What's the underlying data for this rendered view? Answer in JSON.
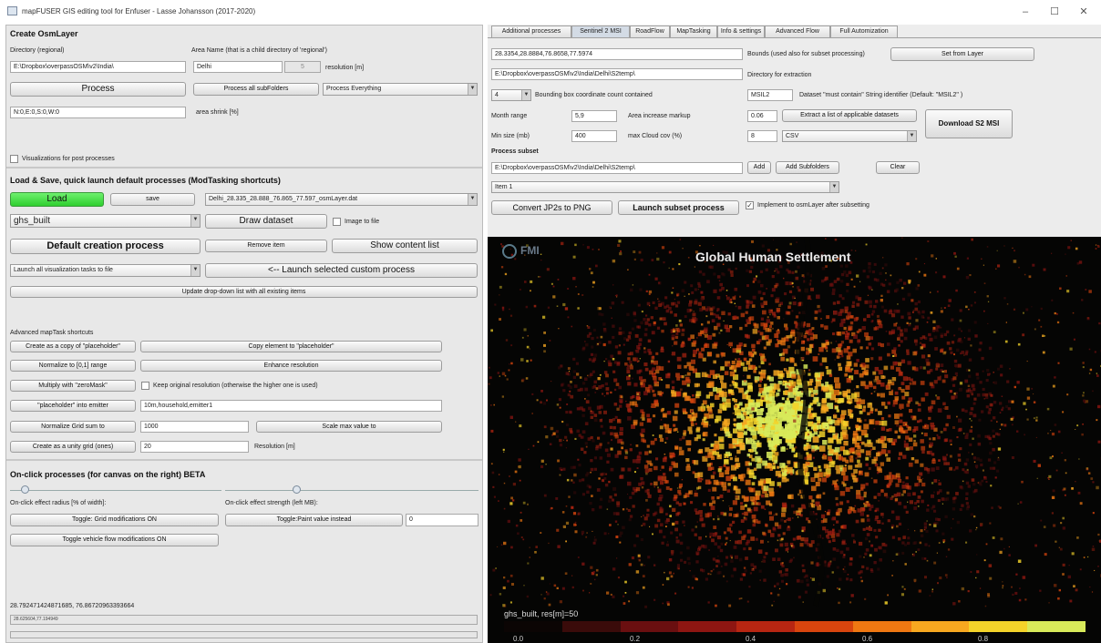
{
  "window": {
    "title": "mapFUSER GIS editing tool for Enfuser - Lasse Johansson (2017-2020)",
    "minimize": "–",
    "maximize": "☐",
    "close": "✕"
  },
  "create_osm": {
    "title": "Create OsmLayer",
    "dir_label": "Directory (regional)",
    "dir_value": "E:\\Dropbox\\overpassOSM\\v2\\India\\",
    "area_label": "Area Name (that is a child directory of 'regional')",
    "area_value": "Delhi",
    "res_value": "5",
    "res_label": "resolution [m]",
    "process_btn": "Process",
    "process_all_btn": "Process all subFolders",
    "process_mode": "Process Everything",
    "shrink_value": "N:0,E:0,S:0,W:0",
    "shrink_label": "area shrink [%]",
    "vis_label": "Visualizations for post processes"
  },
  "load_save": {
    "title": "Load & Save, quick launch default processes (ModTasking shortcuts)",
    "load_btn": "Load",
    "save_btn": "save",
    "file_value": "Delhi_28.335_28.888_76.865_77.597_osmLayer.dat",
    "dataset_value": "ghs_built",
    "draw_btn": "Draw dataset",
    "image_label": "Image to file",
    "default_btn": "Default creation process",
    "remove_btn": "Remove item",
    "show_btn": "Show content list",
    "launch_all": "Launch all visualization tasks to file",
    "launch_custom_btn": "<-- Launch selected custom process",
    "update_btn": "Update drop-down list with all existing items",
    "adv_label": "Advanced mapTask shortcuts",
    "copy_as_btn": "Create as a copy of \"placeholder\"",
    "copy_to_btn": "Copy element to \"placeholder\"",
    "normalize_btn": "Normalize to [0,1] range",
    "enhance_btn": "Enhance resolution",
    "multiply_btn": "Multiply with \"zeroMask\"",
    "keep_label": "Keep original resolution (otherwise the higher one is used)",
    "emitter_btn": "\"placeholder\" into emitter",
    "emitter_value": "10m,household,emitter1",
    "grid_sum_btn": "Normalize Grid sum to",
    "grid_sum_value": "1000",
    "scale_btn": "Scale max value to",
    "unity_btn": "Create as a unity grid (ones)",
    "unity_value": "20",
    "res_label": "Resolution [m]"
  },
  "onclick": {
    "title": "On-click processes (for canvas on the right) BETA",
    "radius_label": "On-click effect radius [% of width]:",
    "strength_label": "On-click effect strength (left MB):",
    "radius_level": 0.07,
    "strength_level": 0.28,
    "grid_btn": "Toggle: Grid modifications ON",
    "paint_btn": "Toggle:Paint value instead",
    "paint_value": "0",
    "vehicle_btn": "Toggle vehicle flow modifications ON",
    "coords": "28.792471424871685, 76.86720963393664",
    "coords2": "28.625604,77.194949"
  },
  "tabs": [
    {
      "label": "Additional processes",
      "active": false
    },
    {
      "label": "Sentinel 2 MSI",
      "active": true
    },
    {
      "label": "RoadFlow",
      "active": false
    },
    {
      "label": "MapTasking",
      "active": false
    },
    {
      "label": "Info & settings",
      "active": false
    },
    {
      "label": "Advanced Flow",
      "active": false
    },
    {
      "label": "Full Automization",
      "active": false
    }
  ],
  "sentinel": {
    "bounds_value": "28.3354,28.8884,76.8658,77.5974",
    "bounds_label": "Bounds (used also for subset processing)",
    "set_layer_btn": "Set from Layer",
    "dir_value": "E:\\Dropbox\\overpassOSM\\v2\\India\\Delhi\\S2temp\\",
    "dir_label": "Directory for extraction",
    "count_value": "4",
    "count_label": "Bounding box coordinate count contained",
    "id_value": "MSIL2",
    "id_label": "Dataset \"must contain\" String identifier (Default: \"MSIL2\" )",
    "month_label": "Month range",
    "month_value": "5,9",
    "area_label": "Area increase markup",
    "area_value": "0.06",
    "extract_btn": "Extract a list of applicable datasets",
    "download_btn": "Download S2 MSI",
    "min_label": "Min size (mb)",
    "min_value": "400",
    "cloud_label": "max Cloud cov (%)",
    "cloud_value": "8",
    "format_value": "CSV",
    "subset_label": "Process subset",
    "subset_value": "E:\\Dropbox\\overpassOSM\\v2\\India\\Delhi\\S2temp\\",
    "add_btn": "Add",
    "add_sub_btn": "Add Subfolders",
    "clear_btn": "Clear",
    "item_value": "Item 1",
    "convert_btn": "Convert JP2s to PNG",
    "launch_btn": "Launch subset process",
    "implement_label": "Implement to osmLayer after subsetting"
  },
  "map": {
    "logo": "FMI",
    "title": "Global Human Settlement",
    "colorbar_title": "ghs_built, res[m]=50",
    "ticks": [
      "0.0",
      "0.2",
      "0.4",
      "0.6",
      "0.8"
    ],
    "colors": [
      "#0b0504",
      "#3a0b0a",
      "#6a0f10",
      "#8e1612",
      "#b72612",
      "#d8450e",
      "#ef7812",
      "#f7a820",
      "#f4d32a",
      "#d8ea5a"
    ]
  }
}
